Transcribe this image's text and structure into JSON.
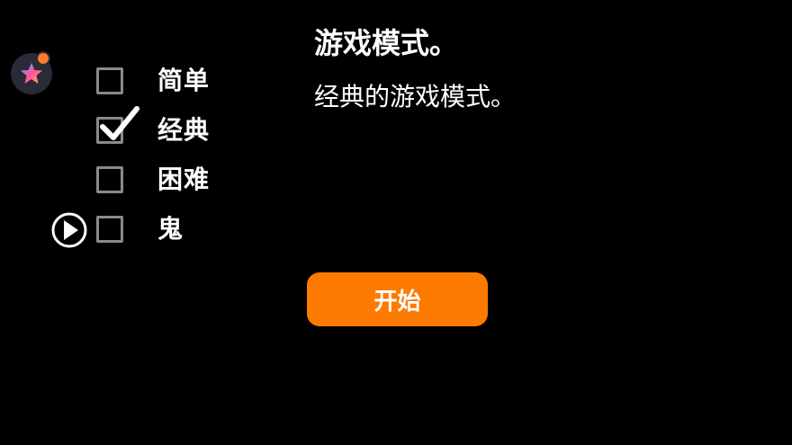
{
  "title": "游戏模式。",
  "description": "经典的游戏模式。",
  "modes": [
    {
      "label": "简单",
      "checked": false
    },
    {
      "label": "经典",
      "checked": true
    },
    {
      "label": "困难",
      "checked": false
    },
    {
      "label": "鬼",
      "checked": false
    }
  ],
  "pointer_index": 3,
  "start_button": {
    "label": "开始"
  },
  "colors": {
    "background": "#000000",
    "accent": "#ff7a00",
    "checkbox_border": "#8a8a8a",
    "text": "#ffffff"
  },
  "icons": {
    "app": "star-app-icon",
    "check": "checkmark-icon",
    "pointer": "play-circle-icon"
  }
}
